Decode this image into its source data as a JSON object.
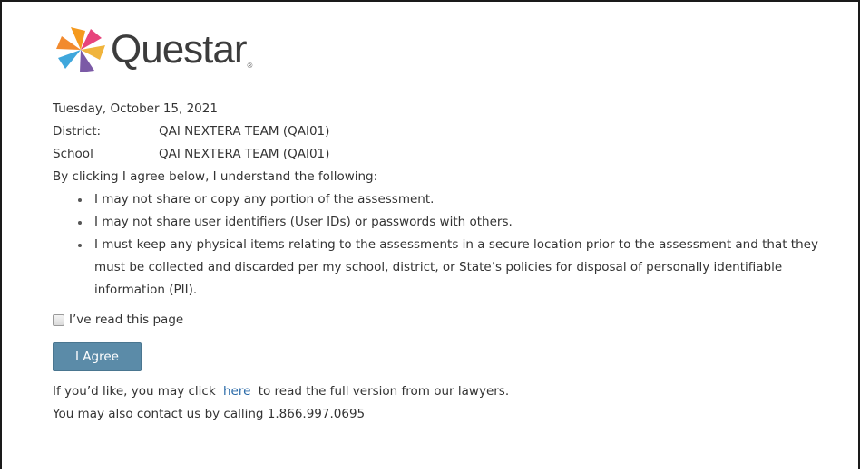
{
  "brand": {
    "name": "Questar",
    "reg": "®"
  },
  "date": "Tuesday, October 15, 2021",
  "district": {
    "label": "District:",
    "value": "QAI NEXTERA TEAM (QAI01)"
  },
  "school": {
    "label": "School",
    "value": "QAI NEXTERA TEAM (QAI01)"
  },
  "intro": "By clicking I agree below, I understand the following:",
  "terms": [
    "I may not share or copy any portion of the assessment.",
    "I may not share user identifiers (User IDs) or passwords with others.",
    "I must keep any physical items relating to the assessments in a secure location prior to the assessment and that they must be collected and discarded per my school, district, or State’s policies for disposal of personally identifiable information (PII)."
  ],
  "acknowledge": {
    "label": "I’ve read this page",
    "checked": false
  },
  "agree_button": "I Agree",
  "footer": {
    "link_prefix": "If you’d like, you may click",
    "link_text": "here",
    "link_suffix": "to read the full version from our lawyers.",
    "contact": "You may also contact us by calling 1.866.997.0695"
  },
  "colors": {
    "button": "#5b8ba8",
    "link": "#2a6aa8",
    "logo_orange": "#f59a1e",
    "logo_blue": "#3fa7dc",
    "logo_pink": "#e7447c",
    "logo_purple": "#7b5aa6"
  },
  "icons": [
    "questar-logo-icon",
    "checkbox-unchecked-icon"
  ]
}
